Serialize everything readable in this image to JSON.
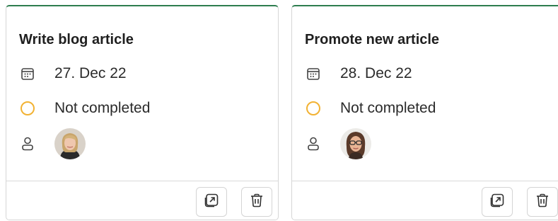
{
  "tasks": [
    {
      "title": "Write blog article",
      "due_date": "27. Dec 22",
      "status": "Not completed",
      "status_color": "#f2b233",
      "assignee_avatar": "avatar-woman-blonde"
    },
    {
      "title": "Promote new article",
      "due_date": "28. Dec 22",
      "status": "Not completed",
      "status_color": "#f2b233",
      "assignee_avatar": "avatar-woman-glasses"
    }
  ],
  "icons": {
    "date": "calendar-icon",
    "status": "status-circle-icon",
    "assignee": "person-icon",
    "open": "open-in-new-icon",
    "delete": "trash-icon"
  },
  "colors": {
    "accent_top_border": "#2e7d4f",
    "status_not_completed": "#f2b233"
  }
}
